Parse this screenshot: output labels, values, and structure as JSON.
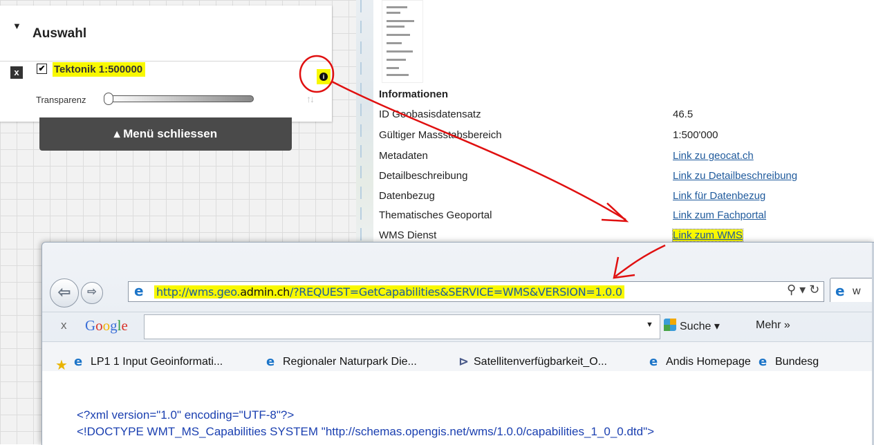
{
  "layer_panel": {
    "title": "Auswahl",
    "remove_icon": "x",
    "layer": {
      "checked": true,
      "name": "Tektonik 1:500000"
    },
    "info_icon": "info-icon",
    "transparency_label": "Transparenz",
    "transparency_value": 0,
    "menu_close": "▴ Menü schliessen"
  },
  "info": {
    "heading": "Informationen",
    "rows": [
      {
        "label": "ID Geobasisdatensatz",
        "value": "46.5",
        "link": false
      },
      {
        "label": "Gültiger Massstabsbereich",
        "value": "1:500'000",
        "link": false
      },
      {
        "label": "Metadaten",
        "value": "Link zu geocat.ch",
        "link": true
      },
      {
        "label": "Detailbeschreibung",
        "value": "Link zu Detailbeschreibung",
        "link": true
      },
      {
        "label": "Datenbezug",
        "value": "Link für Datenbezug",
        "link": true
      },
      {
        "label": "Thematisches Geoportal",
        "value": "Link zum Fachportal",
        "link": true
      },
      {
        "label": "WMS Dienst",
        "value": "Link zum WMS",
        "link": true
      }
    ]
  },
  "browser": {
    "url_prefix": "http://wms.geo.",
    "url_bold": "admin.ch",
    "url_suffix": "/?REQUEST=GetCapabilities&SERVICE=WMS&VERSION=1.0.0",
    "tab_label": "w",
    "toolbar_close": "x",
    "google_label": "Google",
    "search_button": "Suche",
    "more_button": "Mehr »",
    "favorites": [
      "LP1 1 Input Geoinformati...",
      "Regionaler Naturpark Die...",
      "Satellitenverfügbarkeit_O...",
      "Andis Homepage",
      "Bundesg"
    ],
    "content": [
      "<?xml version=\"1.0\" encoding=\"UTF-8\"?>",
      "<!DOCTYPE WMT_MS_Capabilities SYSTEM \"http://schemas.opengis.net/wms/1.0.0/capabilities_1_0_0.dtd\">"
    ]
  },
  "colors": {
    "highlight": "#f8f800",
    "link": "#1f5a9c",
    "annotation": "#e01010"
  }
}
